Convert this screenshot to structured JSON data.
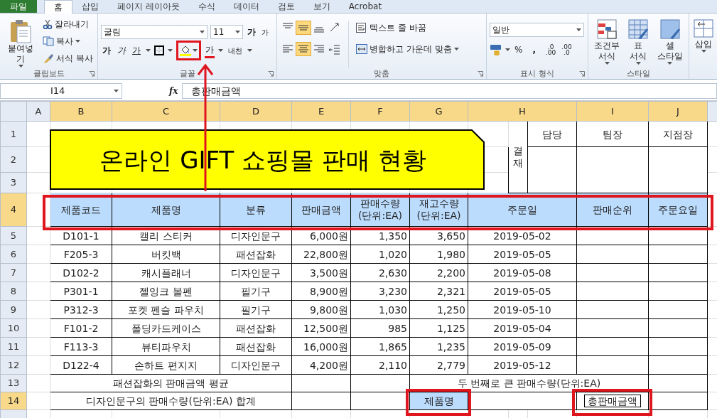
{
  "tabs": [
    {
      "label": "파일",
      "kind": "file",
      "selected": false
    },
    {
      "label": "홈",
      "kind": "tab",
      "selected": true
    },
    {
      "label": "삽입",
      "kind": "tab",
      "selected": false
    },
    {
      "label": "페이지 레이아웃",
      "kind": "tab",
      "selected": false
    },
    {
      "label": "수식",
      "kind": "tab",
      "selected": false
    },
    {
      "label": "데이터",
      "kind": "tab",
      "selected": false
    },
    {
      "label": "검토",
      "kind": "tab",
      "selected": false
    },
    {
      "label": "보기",
      "kind": "tab",
      "selected": false
    },
    {
      "label": "Acrobat",
      "kind": "tab",
      "selected": false
    }
  ],
  "ribbon": {
    "clipboard": {
      "paste": "붙여넣기",
      "cut": "잘라내기",
      "copy": "복사",
      "format_painter": "서식 복사",
      "label": "클립보드"
    },
    "font": {
      "font_name": "굴림",
      "font_size": "11",
      "grow": "가",
      "shrink": "가",
      "styles": [
        {
          "kind": "bold",
          "label": "가"
        },
        {
          "kind": "italic",
          "label": "가"
        },
        {
          "kind": "underline",
          "label": "가"
        }
      ],
      "font_color": "가",
      "phonetic": "내천",
      "label": "글꼴"
    },
    "alignment": {
      "buttons": [
        {
          "kind": "top",
          "selected": false
        },
        {
          "kind": "middle",
          "selected": true
        },
        {
          "kind": "bottom",
          "selected": false
        },
        {
          "kind": "left",
          "selected": false
        },
        {
          "kind": "center",
          "selected": true
        },
        {
          "kind": "right",
          "selected": false
        }
      ],
      "wrap_text": "텍스트 줄 바꿈",
      "merge_center": "병합하고 가운데 맞춤",
      "label": "맞춤"
    },
    "number": {
      "format": "일반",
      "percent": "%",
      "comma": ",",
      "increase_decimal": [
        ".0",
        ".00"
      ],
      "decrease_decimal": [
        ".00",
        ".0"
      ],
      "label": "표시 형식"
    },
    "styles": {
      "buttons": [
        {
          "kind": "conditional",
          "label": "조건부\n서식"
        },
        {
          "kind": "table",
          "label": "표\n서식"
        },
        {
          "kind": "cell",
          "label": "셀\n스타일"
        }
      ],
      "label": "스타일"
    },
    "cells": {
      "insert": "삽입"
    }
  },
  "formula_bar": {
    "name_box": "I14",
    "fx": "fx",
    "formula": "총판매금액"
  },
  "sheet": {
    "columns": [
      {
        "label": "A",
        "selected": false
      },
      {
        "label": "B",
        "selected": true
      },
      {
        "label": "C",
        "selected": true
      },
      {
        "label": "D",
        "selected": true
      },
      {
        "label": "E",
        "selected": true
      },
      {
        "label": "F",
        "selected": true
      },
      {
        "label": "G",
        "selected": true
      },
      {
        "label": "H",
        "selected": true
      },
      {
        "label": "I",
        "selected": true
      },
      {
        "label": "J",
        "selected": true
      }
    ],
    "row_numbers": [
      {
        "label": "1",
        "selected": false
      },
      {
        "label": "2",
        "selected": false
      },
      {
        "label": "3",
        "selected": false
      },
      {
        "label": "4",
        "selected": true
      },
      {
        "label": "5",
        "selected": false
      },
      {
        "label": "6",
        "selected": false
      },
      {
        "label": "7",
        "selected": false
      },
      {
        "label": "8",
        "selected": false
      },
      {
        "label": "9",
        "selected": false
      },
      {
        "label": "10",
        "selected": false
      },
      {
        "label": "11",
        "selected": false
      },
      {
        "label": "12",
        "selected": false
      },
      {
        "label": "13",
        "selected": false
      },
      {
        "label": "14",
        "selected": true
      }
    ],
    "title": "온라인 GIFT 쇼핑몰 판매 현황",
    "approval": {
      "label": "결재",
      "roles": [
        "담당",
        "팀장",
        "지점장"
      ]
    },
    "table": {
      "columns": [
        "제품코드",
        "제품명",
        "분류",
        "판매금액",
        "판매수량\n(단위:EA)",
        "재고수량\n(단위:EA)",
        "주문일",
        "판매순위",
        "주문요일"
      ],
      "rows": [
        [
          "D101-1",
          "캘리 스티커",
          "디자인문구",
          "6,000원",
          "1,350",
          "3,650",
          "2019-05-02"
        ],
        [
          "F205-3",
          "버킷백",
          "패션잡화",
          "22,800원",
          "1,020",
          "1,980",
          "2019-05-05"
        ],
        [
          "D102-2",
          "캐시플래너",
          "디자인문구",
          "3,500원",
          "2,630",
          "2,200",
          "2019-05-08"
        ],
        [
          "P301-1",
          "젤잉크 볼펜",
          "필기구",
          "8,900원",
          "3,230",
          "2,321",
          "2019-05-05"
        ],
        [
          "P312-3",
          "포켓 펜슬 파우치",
          "필기구",
          "9,800원",
          "1,030",
          "1,250",
          "2019-05-10"
        ],
        [
          "F101-2",
          "폴딩카드케이스",
          "패션잡화",
          "12,500원",
          "985",
          "1,125",
          "2019-05-04"
        ],
        [
          "F113-3",
          "뷰티파우치",
          "패션잡화",
          "16,000원",
          "1,865",
          "1,235",
          "2019-05-09"
        ],
        [
          "D122-4",
          "손하트 편지지",
          "디자인문구",
          "4,200원",
          "2,110",
          "2,779",
          "2019-05-12"
        ]
      ]
    },
    "summary": {
      "fashion_average_label": "패션잡화의 판매금액 평균",
      "second_largest_label": "두 번째로 큰 판매수량(단위:EA)",
      "design_sum_label": "디자인문구의 판매수량(단위:EA) 합계",
      "g14": "제품명",
      "i14": "총판매금액"
    }
  }
}
